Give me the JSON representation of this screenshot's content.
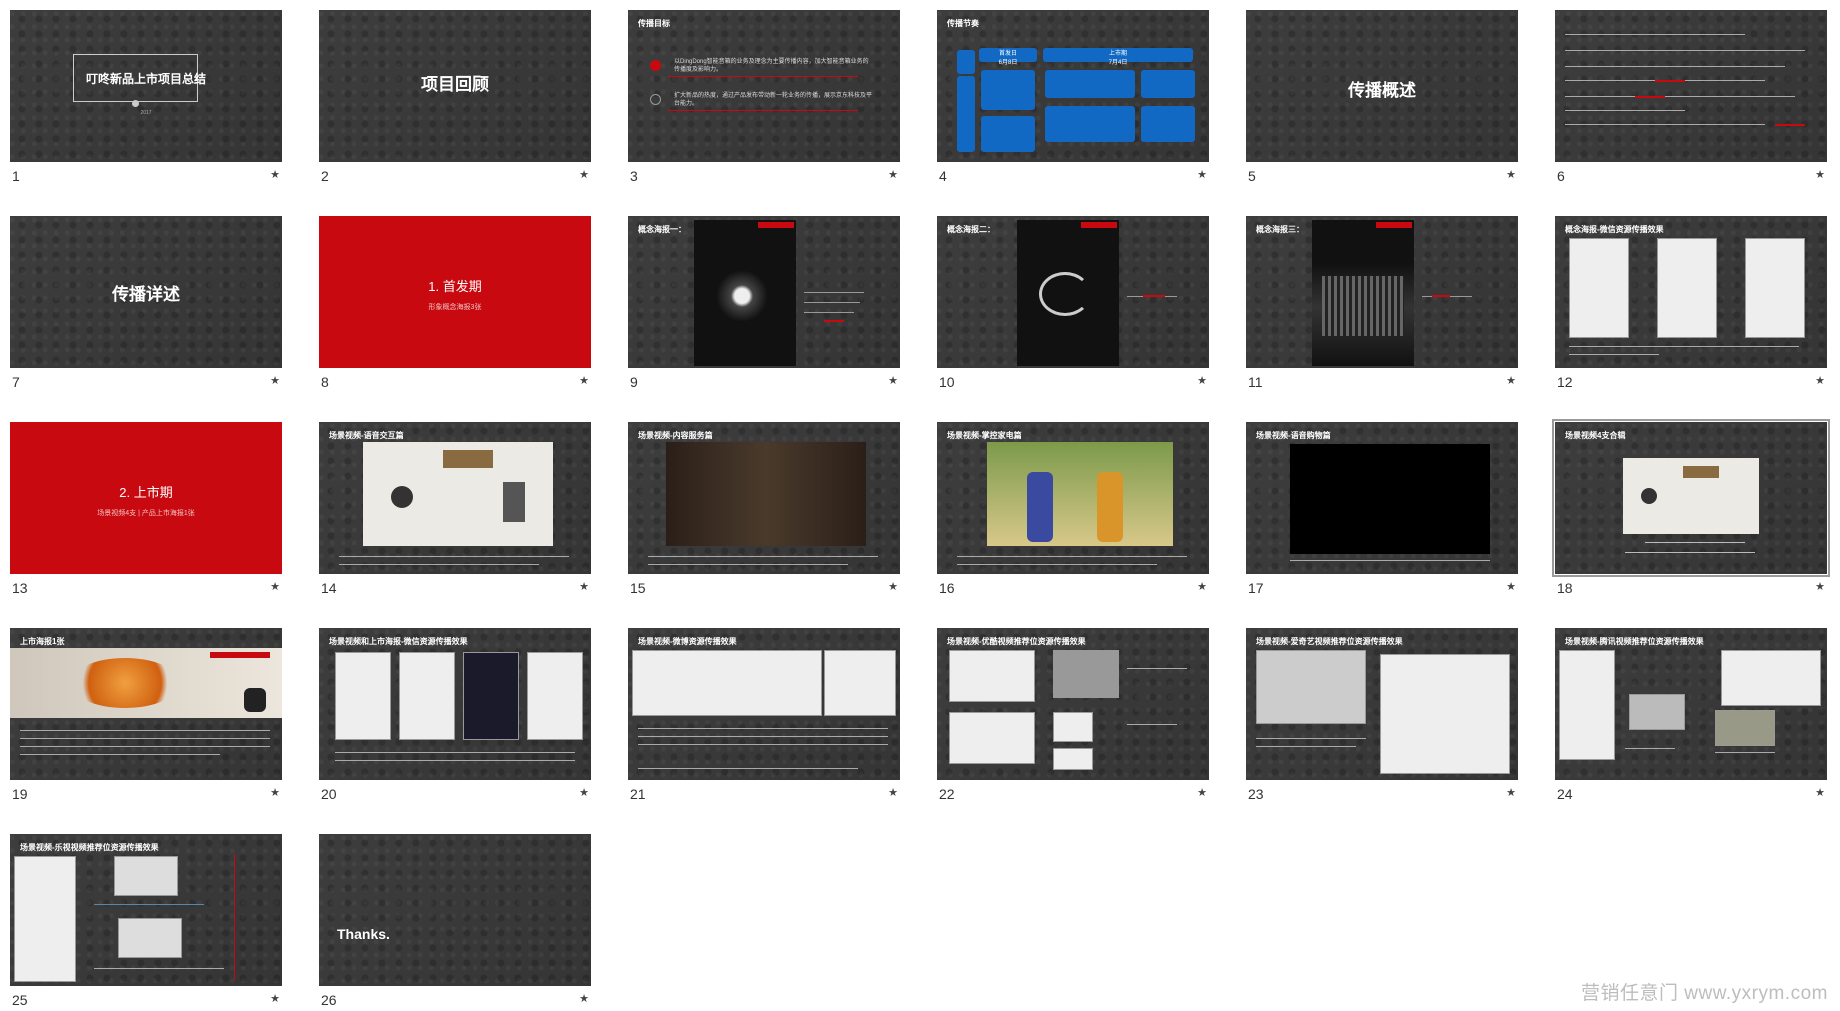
{
  "slides": [
    {
      "number": "1",
      "title": "叮咚新品上市项目总结",
      "subtitle": "2017"
    },
    {
      "number": "2",
      "title": "项目回顾"
    },
    {
      "number": "3",
      "title": "传播目标",
      "body": [
        "以DingDong智能音箱的业务及理念为主要传播内容，加大智能音箱业务的传播度及影响力。",
        "扩大新品的热度，通过产品发布带动新一轮业务的传播，展示京东科技及平台能力。"
      ]
    },
    {
      "number": "4",
      "title": "传播节奏",
      "labels": [
        "首发日",
        "上市期",
        "6月8日",
        "7月4日"
      ]
    },
    {
      "number": "5",
      "title": "传播概述"
    },
    {
      "number": "6",
      "title": ""
    },
    {
      "number": "7",
      "title": "传播详述"
    },
    {
      "number": "8",
      "title": "1. 首发期",
      "subtitle": "形象概念海报3张"
    },
    {
      "number": "9",
      "title": "概念海报一："
    },
    {
      "number": "10",
      "title": "概念海报二："
    },
    {
      "number": "11",
      "title": "概念海报三："
    },
    {
      "number": "12",
      "title": "概念海报-微信资源传播效果"
    },
    {
      "number": "13",
      "title": "2. 上市期",
      "subtitle": "场景视频4支 | 产品上市海报1张"
    },
    {
      "number": "14",
      "title": "场景视频-语音交互篇"
    },
    {
      "number": "15",
      "title": "场景视频-内容服务篇"
    },
    {
      "number": "16",
      "title": "场景视频-掌控家电篇"
    },
    {
      "number": "17",
      "title": "场景视频-语音购物篇"
    },
    {
      "number": "18",
      "title": "场景视频4支合辑"
    },
    {
      "number": "19",
      "title": "上市海报1张"
    },
    {
      "number": "20",
      "title": "场景视频和上市海报-微信资源传播效果"
    },
    {
      "number": "21",
      "title": "场景视频-微博资源传播效果"
    },
    {
      "number": "22",
      "title": "场景视频-优酷视频推荐位资源传播效果"
    },
    {
      "number": "23",
      "title": "场景视频-爱奇艺视频推荐位资源传播效果"
    },
    {
      "number": "24",
      "title": "场景视频-腾讯视频推荐位资源传播效果"
    },
    {
      "number": "25",
      "title": "场景视频-乐视视频推荐位资源传播效果"
    },
    {
      "number": "26",
      "title": "Thanks."
    }
  ],
  "star_glyph": "★",
  "watermark": "营销任意门 www.yxrym.com",
  "colors": {
    "slide_bg": "#3a3a3a",
    "accent_red": "#c8090f",
    "blue": "#1169c4"
  }
}
